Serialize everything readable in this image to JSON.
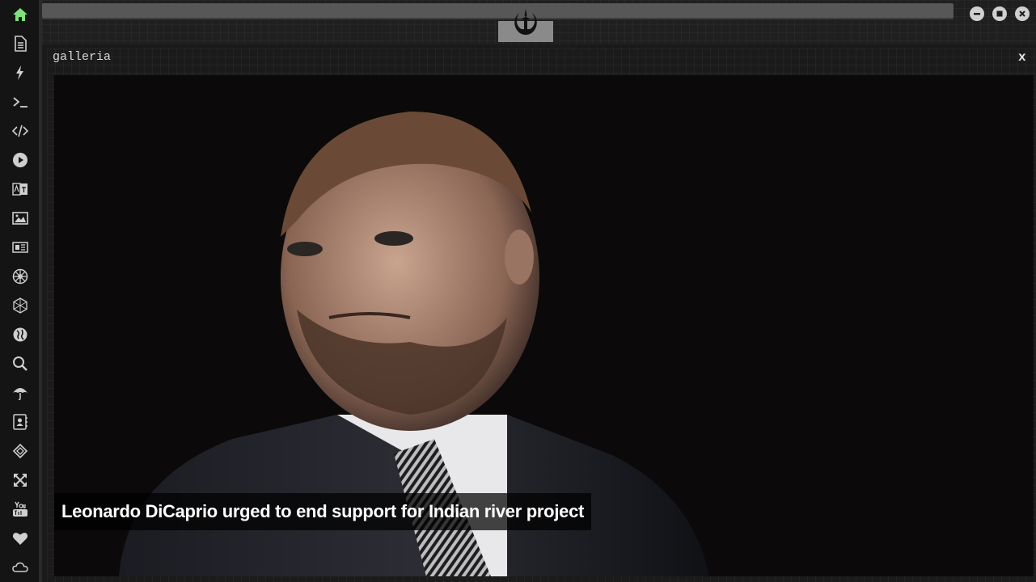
{
  "window": {
    "title": "galleria",
    "close_label": "x"
  },
  "gallery": {
    "caption": "Leonardo DiCaprio urged to end support for Indian river project"
  },
  "sidebar": {
    "items": [
      {
        "icon": "home-icon",
        "active": true
      },
      {
        "icon": "document-icon"
      },
      {
        "icon": "lightning-icon"
      },
      {
        "icon": "terminal-icon"
      },
      {
        "icon": "code-icon"
      },
      {
        "icon": "play-icon"
      },
      {
        "icon": "translate-icon"
      },
      {
        "icon": "image-icon"
      },
      {
        "icon": "newspaper-icon"
      },
      {
        "icon": "empire-icon"
      },
      {
        "icon": "network-icon"
      },
      {
        "icon": "globe-icon"
      },
      {
        "icon": "search-icon"
      },
      {
        "icon": "umbrella-icon"
      },
      {
        "icon": "contacts-icon"
      },
      {
        "icon": "codepen-icon"
      },
      {
        "icon": "expand-icon"
      },
      {
        "icon": "youtube-icon"
      },
      {
        "icon": "heart-icon"
      },
      {
        "icon": "cloud-icon"
      }
    ]
  },
  "colors": {
    "sidebar_bg": "#141414",
    "active_icon": "#7ee07e",
    "icon": "#cfcfcf"
  }
}
